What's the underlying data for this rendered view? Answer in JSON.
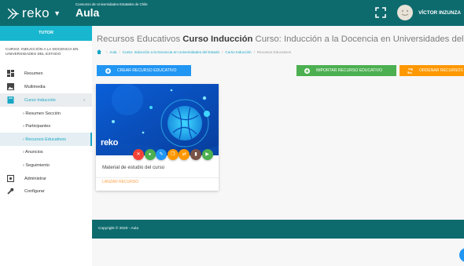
{
  "header": {
    "logo_text": "reko",
    "consortium": "Consorcio de Universidades Estatales de Chile",
    "app_name": "Aula",
    "username": "VÍCTOR INZUNZA"
  },
  "sidebar": {
    "role": "TUTOR",
    "course_name": "CURSO: INDUCCIÓN A LA DOCENCIA EN UNIVERSIDADES DEL ESTADO",
    "items": [
      {
        "label": "Resumen",
        "icon": "dashboard-icon"
      },
      {
        "label": "Multimedia",
        "icon": "image-icon"
      },
      {
        "label": "Curso Inducción",
        "icon": "book-icon"
      },
      {
        "label": "Administrar",
        "icon": "cog-icon"
      },
      {
        "label": "Configurar",
        "icon": "wrench-icon"
      }
    ],
    "sub_items": [
      {
        "label": "› Resumen Sección"
      },
      {
        "label": "› Participantes"
      },
      {
        "label": "› Recursos Educativos"
      },
      {
        "label": "› Anuncios"
      },
      {
        "label": "› Seguimiento"
      }
    ]
  },
  "main": {
    "title_prefix": "Recursos Educativos",
    "title_bold": "Curso Inducción",
    "title_suffix": "Curso: Inducción a la Docencia en Universidades del Estado",
    "breadcrumbs": [
      "Aula",
      "Curso: Inducción a la Docencia en Universidades del Estado",
      "Curso Inducción",
      "Recursos Educativos"
    ],
    "buttons": {
      "create": "CREAR RECURSO EDUCATIVO",
      "import": "IMPORTAR RECURSO EDUCATIVO",
      "order": "ORDENAR RECURSOS"
    },
    "card": {
      "logo": "reko",
      "title": "Material de estudio del curso",
      "launch": "LANZAR RECURSO",
      "actions": [
        {
          "icon": "close-icon",
          "glyph": "✕",
          "color": "#f44336"
        },
        {
          "icon": "eye-icon",
          "glyph": "●",
          "color": "#4caf50"
        },
        {
          "icon": "pencil-icon",
          "glyph": "✎",
          "color": "#2196f3"
        },
        {
          "icon": "copy-icon",
          "glyph": "❐",
          "color": "#ff9800"
        },
        {
          "icon": "swap-icon",
          "glyph": "⇄",
          "color": "#ff9800"
        },
        {
          "icon": "file-icon",
          "glyph": "▮",
          "color": "#795548"
        },
        {
          "icon": "play-icon",
          "glyph": "▶",
          "color": "#4caf50"
        }
      ]
    }
  },
  "footer": {
    "copyright": "Copyright © 2020 - Aula"
  },
  "colors": {
    "header": "#0d6b6e",
    "accent": "#19a6c4",
    "primary": "#2196f3",
    "success": "#4caf50",
    "warning": "#ff9800"
  }
}
